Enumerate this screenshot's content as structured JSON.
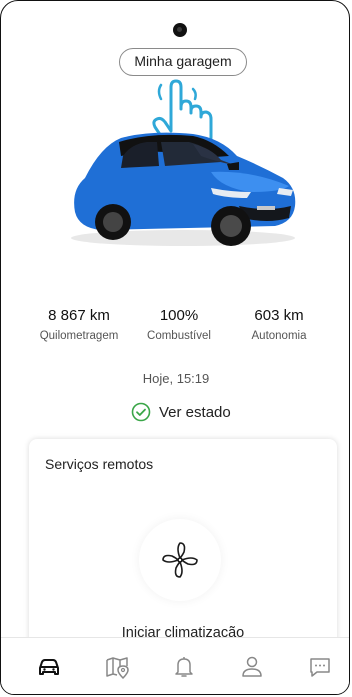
{
  "header": {
    "garage_button_label": "Minha garagem"
  },
  "stats": {
    "mileage_value": "8 867 km",
    "mileage_label": "Quilometragem",
    "fuel_value": "100%",
    "fuel_label": "Combustível",
    "range_value": "603 km",
    "range_label": "Autonomia"
  },
  "status": {
    "updated_time": "Hoje, 15:19",
    "view_status_label": "Ver estado"
  },
  "remote_services": {
    "title": "Serviços remotos",
    "climate_label": "Iniciar climatização"
  },
  "bottom_nav": {
    "items": [
      "car-icon",
      "map-icon",
      "bell-icon",
      "user-icon",
      "chat-icon"
    ],
    "active": "car-icon"
  },
  "colors": {
    "car_body": "#1f6fd6",
    "check_green": "#3aa648",
    "hand_outline": "#2fa8d8"
  }
}
